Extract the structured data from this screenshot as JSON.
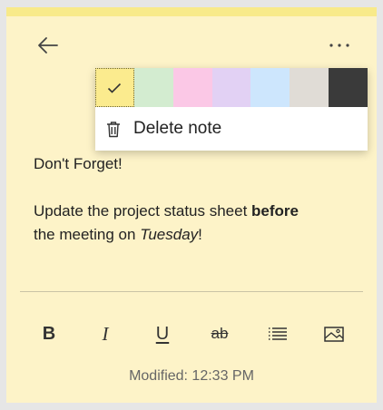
{
  "colors": {
    "note_bg": "#fdf3c8",
    "swatches": [
      "#fbeb8e",
      "#d3ecd0",
      "#fbc8e6",
      "#e2d1f4",
      "#cde6fd",
      "#e0dcd6",
      "#3a3a3a"
    ]
  },
  "header": {
    "back_icon": "arrow-left-icon",
    "more_icon": "ellipsis-icon"
  },
  "menu": {
    "selected_index": 0,
    "delete_label": "Delete note",
    "delete_icon": "trash-icon"
  },
  "note": {
    "line1": "Don't Forget!",
    "line2_a": "Update the project status sheet ",
    "line2_bold": "before",
    "line3_a": "the meeting on ",
    "line3_italic": "Tuesday",
    "line3_b": "!"
  },
  "toolbar": {
    "bold": "B",
    "italic": "I",
    "underline": "U",
    "strikethrough": "ab"
  },
  "footer": {
    "modified": "Modified: 12:33 PM"
  }
}
